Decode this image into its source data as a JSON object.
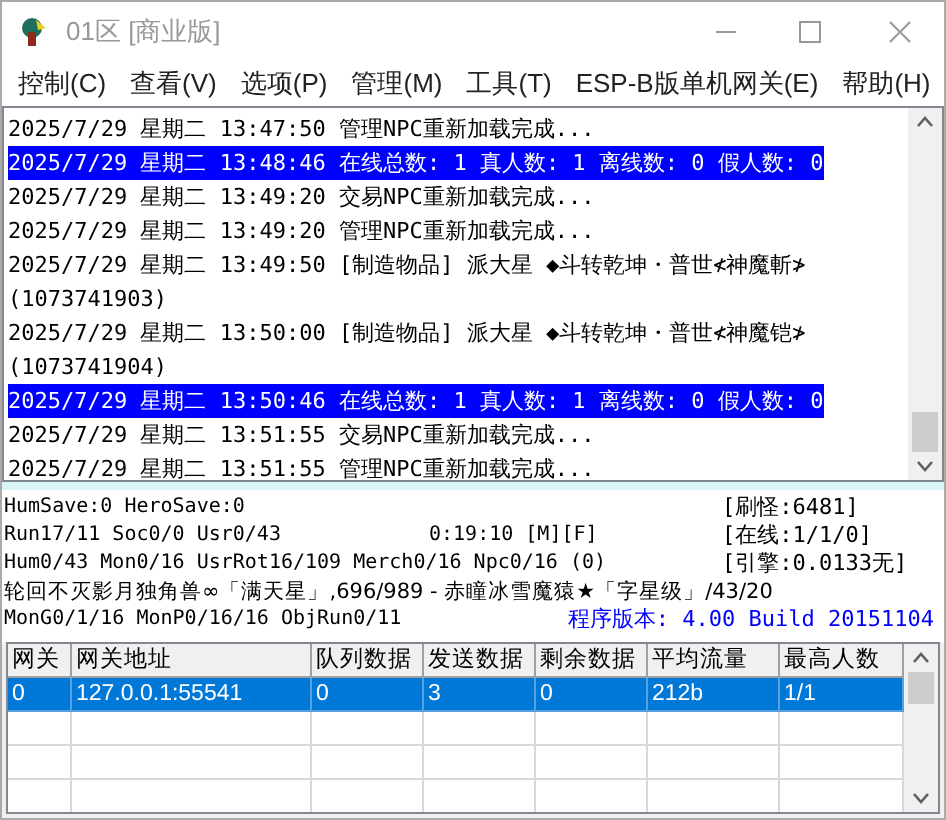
{
  "window": {
    "title": "01区 [商业版]"
  },
  "menu": [
    "控制(C)",
    "查看(V)",
    "选项(P)",
    "管理(M)",
    "工具(T)",
    "ESP-B版单机网关(E)",
    "帮助(H)"
  ],
  "log": [
    {
      "text": "2025/7/29 星期二 13:47:50 管理NPC重新加载完成...",
      "selected": false
    },
    {
      "text": "2025/7/29 星期二 13:48:46 在线总数: 1 真人数: 1 离线数: 0 假人数: 0",
      "selected": true
    },
    {
      "text": "2025/7/29 星期二 13:49:20 交易NPC重新加载完成...",
      "selected": false
    },
    {
      "text": "2025/7/29 星期二 13:49:20 管理NPC重新加载完成...",
      "selected": false
    },
    {
      "text": "2025/7/29 星期二 13:49:50 [制造物品] 派大星 ◆斗转乾坤・普世≮神魔斬≯\n(1073741903)",
      "selected": false
    },
    {
      "text": "2025/7/29 星期二 13:50:00 [制造物品] 派大星 ◆斗转乾坤・普世≮神魔铠≯\n(1073741904)",
      "selected": false
    },
    {
      "text": "2025/7/29 星期二 13:50:46 在线总数: 1 真人数: 1 离线数: 0 假人数: 0",
      "selected": true
    },
    {
      "text": "2025/7/29 星期二 13:51:55 交易NPC重新加载完成...",
      "selected": false
    },
    {
      "text": "2025/7/29 星期二 13:51:55 管理NPC重新加载完成...",
      "selected": false
    }
  ],
  "status": {
    "line_1": "HumSave:0 HeroSave:0",
    "line_2": "Run17/11 Soc0/0 Usr0/43",
    "time": "0:19:10 [M][F]",
    "line_3": "Hum0/43 Mon0/16 UsrRot16/109 Merch0/16 Npc0/16 (0)",
    "line_4": "轮回不灭影月独角兽∞「满天星」,696/989 - 赤瞳冰雪魔猿★「字星级」/43/20",
    "line_5": "MonG0/1/16 MonP0/16/16 ObjRun0/11",
    "monsters": "[刷怪:6481]",
    "online": "[在线:1/1/0]",
    "engine": "[引擎:0.0133无]",
    "version": "程序版本: 4.00 Build 20151104"
  },
  "table": {
    "columns": [
      "网关",
      "网关地址",
      "队列数据",
      "发送数据",
      "剩余数据",
      "平均流量",
      "最高人数"
    ],
    "rows": [
      {
        "cells": [
          "0",
          "127.0.0.1:55541",
          "0",
          "3",
          "0",
          "212b",
          "1/1"
        ],
        "selected": true
      }
    ]
  }
}
